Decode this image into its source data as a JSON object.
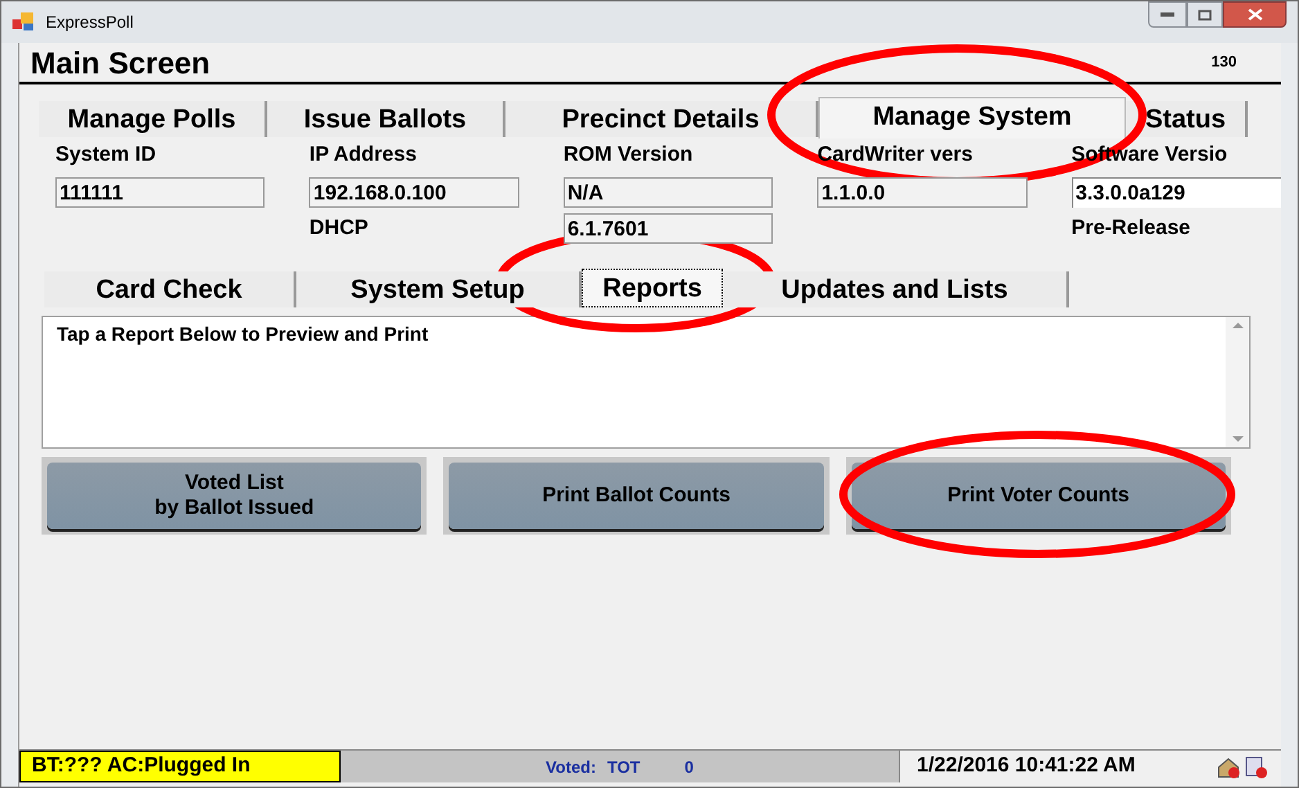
{
  "window": {
    "title": "ExpressPoll"
  },
  "header": {
    "title": "Main Screen",
    "counter": "130"
  },
  "tabs": [
    {
      "label": "Manage Polls",
      "selected": false
    },
    {
      "label": "Issue Ballots",
      "selected": false
    },
    {
      "label": "Precinct Details",
      "selected": false
    },
    {
      "label": "Manage System",
      "selected": true
    },
    {
      "label": "Status",
      "selected": false
    }
  ],
  "info_columns": [
    {
      "label": "System ID",
      "value": "111111"
    },
    {
      "label": "IP Address",
      "value": "192.168.0.100",
      "extra": {
        "kind": "note",
        "text": "DHCP"
      }
    },
    {
      "label": "ROM Version",
      "value": "N/A",
      "extra": {
        "kind": "field",
        "text": "6.1.7601"
      }
    },
    {
      "label": "CardWriter vers",
      "value": "1.1.0.0"
    },
    {
      "label": "Software Versio",
      "value": "3.3.0.0a129",
      "extra": {
        "kind": "note",
        "text": "Pre-Release"
      }
    }
  ],
  "subtabs": [
    {
      "label": "Card Check",
      "selected": false
    },
    {
      "label": "System Setup",
      "selected": false
    },
    {
      "label": "Reports",
      "selected": true
    },
    {
      "label": "Updates and Lists",
      "selected": false
    }
  ],
  "report_box": {
    "text": "Tap a Report Below to Preview and Print"
  },
  "report_buttons": [
    {
      "lines": [
        "Voted List",
        "by Ballot Issued"
      ]
    },
    {
      "lines": [
        "Print Ballot Counts"
      ]
    },
    {
      "lines": [
        "Print Voter Counts"
      ]
    }
  ],
  "status_bar": {
    "power": "BT:??? AC:Plugged In",
    "voted_label": "Voted:",
    "voted_type": "TOT",
    "voted_count": "0",
    "datetime": "1/22/2016 10:41:22 AM"
  }
}
